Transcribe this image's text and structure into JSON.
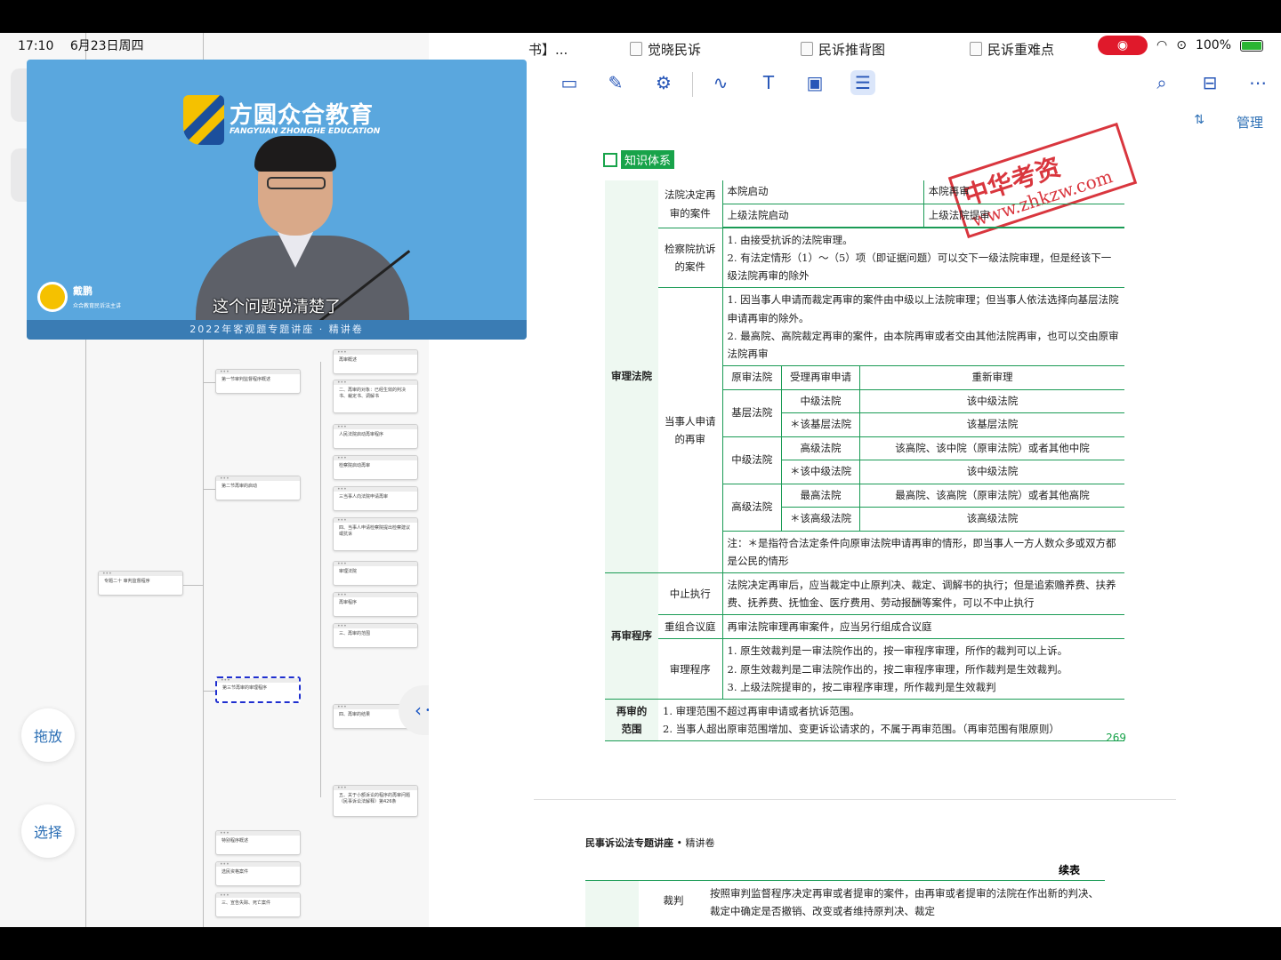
{
  "status": {
    "time": "17:10",
    "date": "6月23日周四",
    "battery": "100%"
  },
  "mindmap": {
    "nodes": [
      "第一节审判监督程序概述",
      "再审概述",
      "二、再审的对象：已经生效的判决书、裁定书、调解书",
      "第二节再审的启动",
      "人民法院启动再审程序",
      "检察院启动再审",
      "三当事人向法院申请再审",
      "四、当事人申请检察院提出检察建议或抗诉",
      "专题二十 审判监督程序",
      "审理法院",
      "再审程序",
      "三、再审的范围",
      "第三节再审的审理程序",
      "四、再审的结果",
      "五、关于小额诉讼的程序的再审问题（民事诉讼法解释）第426条",
      "特别程序概述",
      "选民资格案件",
      "三、宣告失踪、死亡案件"
    ],
    "side_buttons": {
      "drag": "拖放",
      "select": "选择"
    }
  },
  "video": {
    "brand_cn": "方圆众合教育",
    "brand_en": "FANGYUAN ZHONGHE EDUCATION",
    "speaker_name": "戴鹏",
    "speaker_desc": "众合教育民诉法主讲",
    "subtitle": "这个问题说清楚了",
    "banner": "2022年客观题专题讲座 · 精讲卷"
  },
  "reader": {
    "tabs": [
      "书】...",
      "觉晓民诉",
      "民诉推背图",
      "民诉重难点"
    ],
    "manage": "管理"
  },
  "page": {
    "section_label": "知识体系",
    "stamp_line1": "中华考资",
    "stamp_line2": "www.zhkzw.com",
    "rows": {
      "court": "审理法院",
      "fayuan_case": "法院决定再审的案件",
      "benyuan_qidong": "本院启动",
      "benyuan_zaishen": "本院再审",
      "shangji_qidong": "上级法院启动",
      "shangji_tishen": "上级法院提审",
      "jianchayuan_case": "检察院抗诉的案件",
      "jianchayuan_1": "1. 由接受抗诉的法院审理。",
      "jianchayuan_2": "2. 有法定情形（1）～（5）项（即证据问题）可以交下一级法院审理，但是经该下一级法院再审的除外",
      "dangshiren_1": "1. 因当事人申请而裁定再审的案件由中级以上法院审理；但当事人依法选择向基层法院申请再审的除外。",
      "dangshiren_2": "2. 最高院、高院裁定再审的案件，由本院再审或者交由其他法院再审，也可以交由原审法院再审",
      "dangshiren_case": "当事人申请的再审",
      "th_yuanshen": "原审法院",
      "th_shouli": "受理再审申请",
      "th_chongxin": "重新审理",
      "jiceng": "基层法院",
      "zhongji": "中级法院",
      "gaoji": "高级法院",
      "r1_b": "中级法院",
      "r1_c": "该中级法院",
      "r2_b": "＊该基层法院",
      "r2_c": "该基层法院",
      "r3_b": "高级法院",
      "r3_c": "该高院、该中院（原审法院）或者其他中院",
      "r4_b": "＊该中级法院",
      "r4_c": "该中级法院",
      "r5_b": "最高法院",
      "r5_c": "最高院、该高院（原审法院）或者其他高院",
      "r6_b": "＊该高级法院",
      "r6_c": "该高级法院",
      "note": "注：＊是指符合法定条件向原审法院申请再审的情形，即当事人一方人数众多或双方都是公民的情形",
      "procedure": "再审程序",
      "zhongzhi": "中止执行",
      "zhongzhi_txt": "法院决定再审后，应当裁定中止原判决、裁定、调解书的执行；但是追索赡养费、扶养费、抚养费、抚恤金、医疗费用、劳动报酬等案件，可以不中止执行",
      "chongzu": "重组合议庭",
      "chongzu_txt": "再审法院审理再审案件，应当另行组成合议庭",
      "shenli": "审理程序",
      "shenli_1": "1. 原生效裁判是一审法院作出的，按一审程序审理，所作的裁判可以上诉。",
      "shenli_2": "2. 原生效裁判是二审法院作出的，按二审程序审理，所作裁判是生效裁判。",
      "shenli_3": "3. 上级法院提审的，按二审程序审理，所作裁判是生效裁判",
      "fanwei_a": "再审的",
      "fanwei_b": "范围",
      "fanwei_1": "1. 审理范围不超过再审申请或者抗诉范围。",
      "fanwei_2": "2. 当事人超出原审范围增加、变更诉讼请求的，不属于再审范围。（再审范围有限原则）"
    },
    "page_number": "269"
  },
  "page2": {
    "title_bold": "民事诉讼法专题讲座",
    "title_rest": "• 精讲卷",
    "continued": "续表",
    "row_label": "裁判",
    "row_text": "按照审判监督程序决定再审或者提审的案件，由再审或者提审的法院在作出新的判决、裁定中确定是否撤销、改变或者维持原判决、裁定"
  }
}
